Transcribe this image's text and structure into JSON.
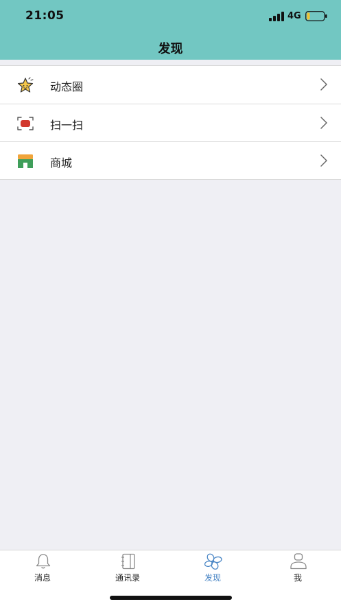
{
  "status_bar": {
    "time": "21:05",
    "network": "4G",
    "signal_icon": "signal-bars-icon",
    "battery_icon": "battery-low-icon",
    "battery_color": "#f2c230"
  },
  "nav": {
    "title": "发现"
  },
  "menu": {
    "items": [
      {
        "label": "动态圈",
        "icon": "star-icon",
        "chevron": "chevron-right-icon"
      },
      {
        "label": "扫一扫",
        "icon": "scan-icon",
        "chevron": "chevron-right-icon"
      },
      {
        "label": "商城",
        "icon": "store-icon",
        "chevron": "chevron-right-icon"
      }
    ]
  },
  "tabbar": {
    "active_color": "#4a86c5",
    "items": [
      {
        "label": "消息",
        "icon": "bell-icon",
        "active": false
      },
      {
        "label": "通讯录",
        "icon": "contacts-book-icon",
        "active": false
      },
      {
        "label": "发现",
        "icon": "fan-icon",
        "active": true
      },
      {
        "label": "我",
        "icon": "person-icon",
        "active": false
      }
    ]
  },
  "colors": {
    "header_bg": "#72c7c2",
    "page_bg": "#efeff4"
  }
}
